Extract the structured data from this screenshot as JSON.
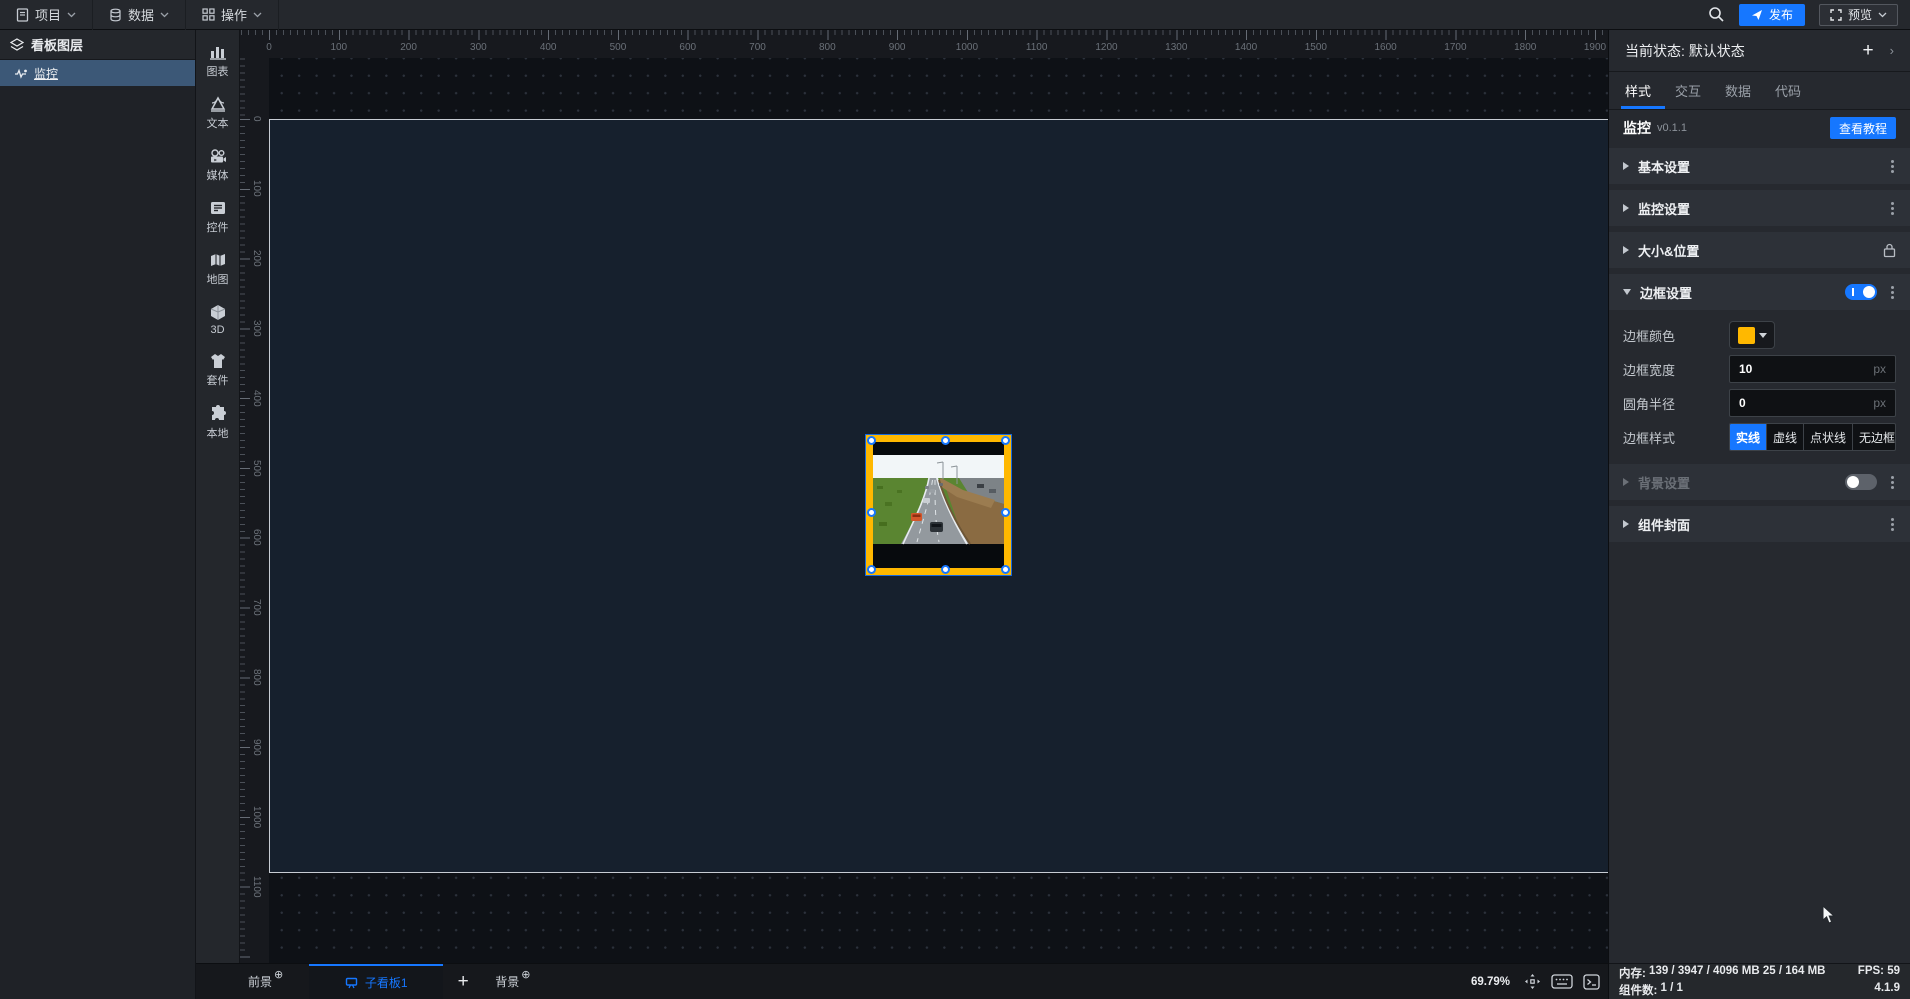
{
  "topbar": {
    "menus": [
      {
        "label": "项目"
      },
      {
        "label": "数据"
      },
      {
        "label": "操作"
      }
    ],
    "publish_label": "发布",
    "preview_label": "预览"
  },
  "layers_panel": {
    "title": "看板图层",
    "items": [
      {
        "label": "监控",
        "selected": true
      }
    ]
  },
  "left_toolbar": {
    "items": [
      {
        "icon": "chart-icon",
        "label": "图表"
      },
      {
        "icon": "text-icon",
        "label": "文本"
      },
      {
        "icon": "media-icon",
        "label": "媒体"
      },
      {
        "icon": "widget-icon",
        "label": "控件"
      },
      {
        "icon": "map-icon",
        "label": "地图"
      },
      {
        "icon": "cube-3d-icon",
        "label": "3D"
      },
      {
        "icon": "kit-icon",
        "label": "套件"
      },
      {
        "icon": "local-icon",
        "label": "本地"
      }
    ]
  },
  "canvas": {
    "ruler_h_labels": [
      "0",
      "100",
      "200",
      "300",
      "400",
      "500",
      "600",
      "700",
      "800",
      "900",
      "1000",
      "1100",
      "1200",
      "1300",
      "1400",
      "1500",
      "1600",
      "1700",
      "1800",
      "1900"
    ],
    "ruler_v_labels": [
      "0",
      "100",
      "200",
      "300",
      "400",
      "500",
      "600",
      "700",
      "800",
      "900",
      "1000",
      "1100"
    ],
    "selected_component": "监控"
  },
  "inspector": {
    "state_label": "当前状态:",
    "state_value": "默认状态",
    "tabs": [
      {
        "label": "样式",
        "active": true
      },
      {
        "label": "交互",
        "active": false
      },
      {
        "label": "数据",
        "active": false
      },
      {
        "label": "代码",
        "active": false
      }
    ],
    "component_name": "监控",
    "component_version": "v0.1.1",
    "tutorial_button": "查看教程",
    "sections": {
      "basic": "基本设置",
      "monitor": "监控设置",
      "size_position": "大小&位置",
      "border": "边框设置",
      "background": "背景设置",
      "cover": "组件封面"
    },
    "border_settings": {
      "color_label": "边框颜色",
      "color_value": "#FFB800",
      "width_label": "边框宽度",
      "width_value": "10",
      "width_unit": "px",
      "radius_label": "圆角半径",
      "radius_value": "0",
      "radius_unit": "px",
      "style_label": "边框样式",
      "style_options": [
        "实线",
        "虚线",
        "点状线",
        "无边框"
      ],
      "style_active": "实线"
    }
  },
  "bottombar": {
    "foreground_tab": "前景",
    "active_board_tab": "子看板1",
    "add_tab": "+",
    "background_tab": "背景",
    "zoom_percent": "69.79%"
  },
  "statusbar": {
    "memory_label": "内存:",
    "memory_value": "139 / 3947 / 4096 MB  25 / 164 MB",
    "fps_label": "FPS:",
    "fps_value": "59",
    "components_label": "组件数:",
    "components_value": "1 / 1",
    "version": "4.1.9"
  },
  "colors": {
    "accent_blue": "#1677FF",
    "border_yellow": "#FFB800",
    "selected_layer_bg": "#3C5877"
  }
}
